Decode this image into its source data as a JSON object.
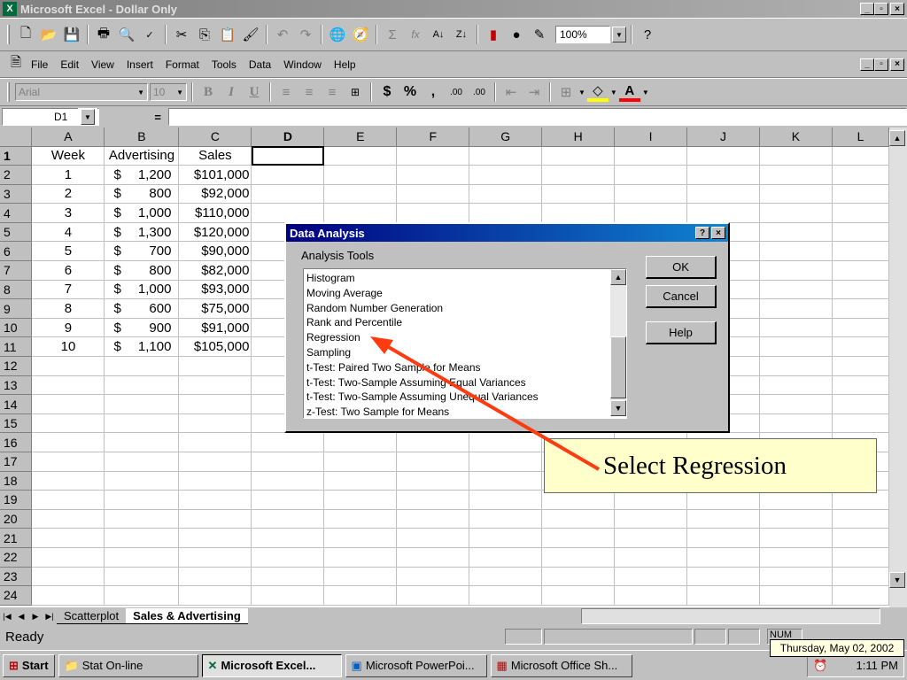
{
  "window": {
    "title": "Microsoft Excel - Dollar  Only",
    "min": "_",
    "max": "▫",
    "close": "×"
  },
  "menu": [
    "File",
    "Edit",
    "View",
    "Insert",
    "Format",
    "Tools",
    "Data",
    "Window",
    "Help"
  ],
  "standard_toolbar": {
    "zoom": "100%"
  },
  "formatting_toolbar": {
    "font": "Arial",
    "size": "10",
    "bold": "B",
    "italic": "I",
    "underline": "U",
    "currency": "$",
    "percent": "%",
    "comma": ",",
    "inc_decimal": ".00",
    "dec_decimal": ".00"
  },
  "formula_bar": {
    "name_box": "D1",
    "equals": "="
  },
  "columns": [
    "A",
    "B",
    "C",
    "D",
    "E",
    "F",
    "G",
    "H",
    "I",
    "J",
    "K",
    "L"
  ],
  "headers": {
    "week": "Week",
    "advertising": "Advertising",
    "sales": "Sales"
  },
  "rows": [
    {
      "week": "1",
      "cur": "$",
      "adv": "1,200",
      "sales": "$101,000"
    },
    {
      "week": "2",
      "cur": "$",
      "adv": "800",
      "sales": "$92,000"
    },
    {
      "week": "3",
      "cur": "$",
      "adv": "1,000",
      "sales": "$110,000"
    },
    {
      "week": "4",
      "cur": "$",
      "adv": "1,300",
      "sales": "$120,000"
    },
    {
      "week": "5",
      "cur": "$",
      "adv": "700",
      "sales": "$90,000"
    },
    {
      "week": "6",
      "cur": "$",
      "adv": "800",
      "sales": "$82,000"
    },
    {
      "week": "7",
      "cur": "$",
      "adv": "1,000",
      "sales": "$93,000"
    },
    {
      "week": "8",
      "cur": "$",
      "adv": "600",
      "sales": "$75,000"
    },
    {
      "week": "9",
      "cur": "$",
      "adv": "900",
      "sales": "$91,000"
    },
    {
      "week": "10",
      "cur": "$",
      "adv": "1,100",
      "sales": "$105,000"
    }
  ],
  "sheet_tabs": {
    "scatterplot": "Scatterplot",
    "active": "Sales & Advertising"
  },
  "status": {
    "ready": "Ready",
    "num": "NUM"
  },
  "dialog": {
    "title": "Data Analysis",
    "help_q": "?",
    "close": "×",
    "list_label": "Analysis Tools",
    "tools": [
      "Histogram",
      "Moving Average",
      "Random Number Generation",
      "Rank and Percentile",
      "Regression",
      "Sampling",
      "t-Test: Paired Two Sample for Means",
      "t-Test: Two-Sample Assuming Equal Variances",
      "t-Test: Two-Sample Assuming Unequal Variances",
      "z-Test: Two Sample for Means"
    ],
    "ok": "OK",
    "cancel": "Cancel",
    "help": "Help"
  },
  "callout": {
    "text": "Select Regression",
    "color": "#ff3b10"
  },
  "taskbar": {
    "start": "Start",
    "stat": "Stat On-line",
    "excel": "Microsoft Excel...",
    "ppt": "Microsoft PowerPoi...",
    "office": "Microsoft Office Sh...",
    "tooltip": "Thursday, May 02, 2002",
    "time": "1:11 PM"
  }
}
